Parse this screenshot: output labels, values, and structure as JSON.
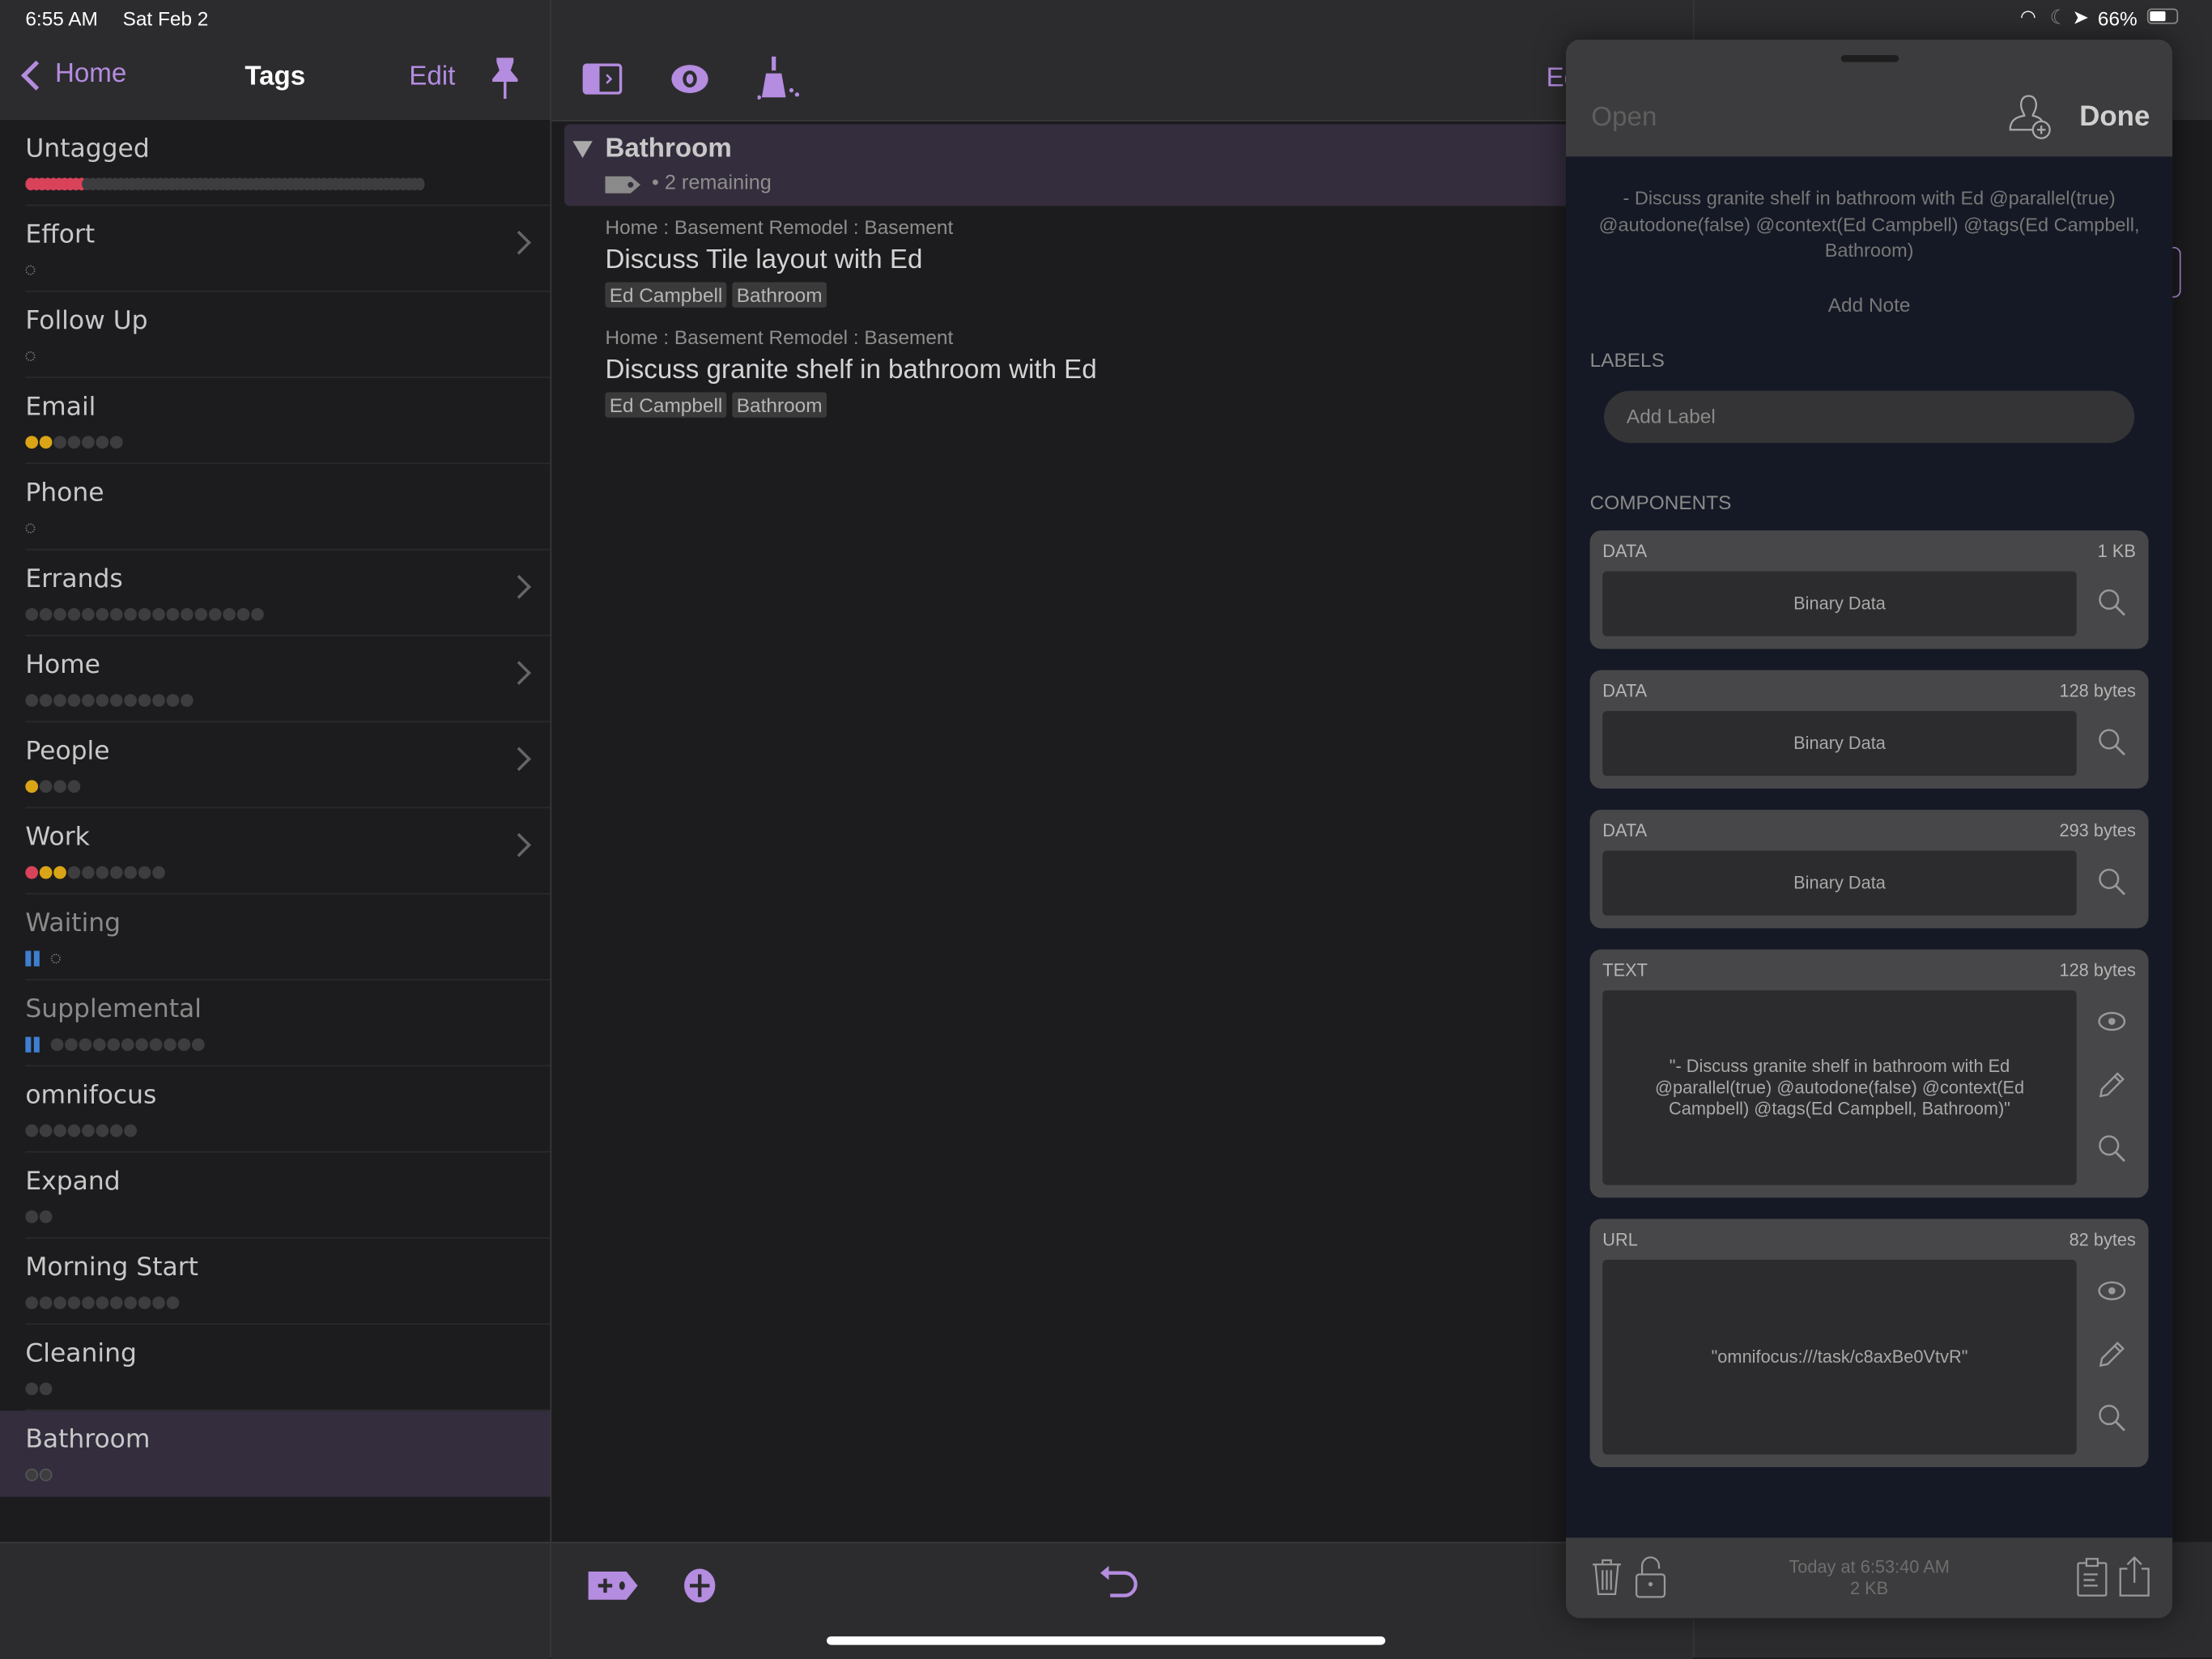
{
  "status_bar": {
    "time": "6:55 AM",
    "date": "Sat Feb 2",
    "battery": "66%"
  },
  "accent_color": "#b48ce0",
  "colors": {
    "red": "#d9435a",
    "yellow": "#d9a516",
    "gray": "#3d3d3f",
    "blue": "#3f7fd0"
  },
  "sidebar": {
    "back_label": "Home",
    "title": "Tags",
    "edit_label": "Edit",
    "pin_icon": "pin-icon",
    "items": [
      {
        "label": "Untagged",
        "dense": true,
        "red": 10,
        "gray": 60
      },
      {
        "label": "Effort",
        "empty": true,
        "chevron": true
      },
      {
        "label": "Follow Up",
        "empty": true
      },
      {
        "label": "Email",
        "yellow": 2,
        "gray": 5
      },
      {
        "label": "Phone",
        "empty": true
      },
      {
        "label": "Errands",
        "gray": 17,
        "chevron": true
      },
      {
        "label": "Home",
        "gray": 12,
        "chevron": true
      },
      {
        "label": "People",
        "yellow": 1,
        "gray": 3,
        "chevron": true
      },
      {
        "label": "Work",
        "red": 1,
        "yellow": 2,
        "gray": 7,
        "chevron": true
      },
      {
        "label": "Waiting",
        "paused": true,
        "empty": true,
        "dim": true
      },
      {
        "label": "Supplemental",
        "paused": true,
        "gray": 11,
        "dim": true
      },
      {
        "label": "omnifocus",
        "gray": 8
      },
      {
        "label": "Expand",
        "gray": 2
      },
      {
        "label": "Morning Start",
        "gray": 11
      },
      {
        "label": "Cleaning",
        "gray": 2
      },
      {
        "label": "Bathroom",
        "gray": 2,
        "outlined": true,
        "selected": true
      }
    ]
  },
  "main": {
    "toolbar_icons": [
      "sidebar-toggle-icon",
      "eye-icon",
      "broom-icon"
    ],
    "edit_label_truncated": "Ed",
    "group": {
      "title": "Bathroom",
      "remaining": "• 2 remaining"
    },
    "tasks": [
      {
        "path": "Home : Basement Remodel : Basement",
        "title": "Discuss Tile layout with Ed",
        "tags": [
          "Ed Campbell",
          "Bathroom"
        ]
      },
      {
        "path": "Home : Basement Remodel : Basement",
        "title": "Discuss granite shelf in bathroom with Ed",
        "tags": [
          "Ed Campbell",
          "Bathroom"
        ]
      }
    ],
    "bottom_icons": [
      "add-tag-icon",
      "add-item-icon",
      "undo-icon"
    ]
  },
  "inspector": {
    "open_label": "Open",
    "done_label": "Done",
    "note_text": "- Discuss granite shelf in bathroom with Ed @parallel(true) @autodone(false) @context(Ed Campbell) @tags(Ed Campbell, Bathroom)",
    "add_note": "Add Note",
    "labels_heading": "LABELS",
    "add_label_placeholder": "Add Label",
    "components_heading": "COMPONENTS",
    "components": [
      {
        "kind": "DATA",
        "size": "1 KB",
        "content": "Binary Data",
        "actions": [
          "search"
        ]
      },
      {
        "kind": "DATA",
        "size": "128 bytes",
        "content": "Binary Data",
        "actions": [
          "search"
        ]
      },
      {
        "kind": "DATA",
        "size": "293 bytes",
        "content": "Binary Data",
        "actions": [
          "search"
        ]
      },
      {
        "kind": "TEXT",
        "size": "128 bytes",
        "content": "\"- Discuss granite shelf in bathroom with Ed @parallel(true) @autodone(false) @context(Ed Campbell) @tags(Ed Campbell, Bathroom)\"",
        "actions": [
          "view",
          "edit",
          "search"
        ]
      },
      {
        "kind": "URL",
        "size": "82 bytes",
        "content": "\"omnifocus:///task/c8axBe0VtvR\"",
        "actions": [
          "view",
          "edit",
          "search"
        ]
      }
    ],
    "footer": {
      "timestamp": "Today at 6:53:40 AM",
      "size": "2 KB"
    }
  }
}
